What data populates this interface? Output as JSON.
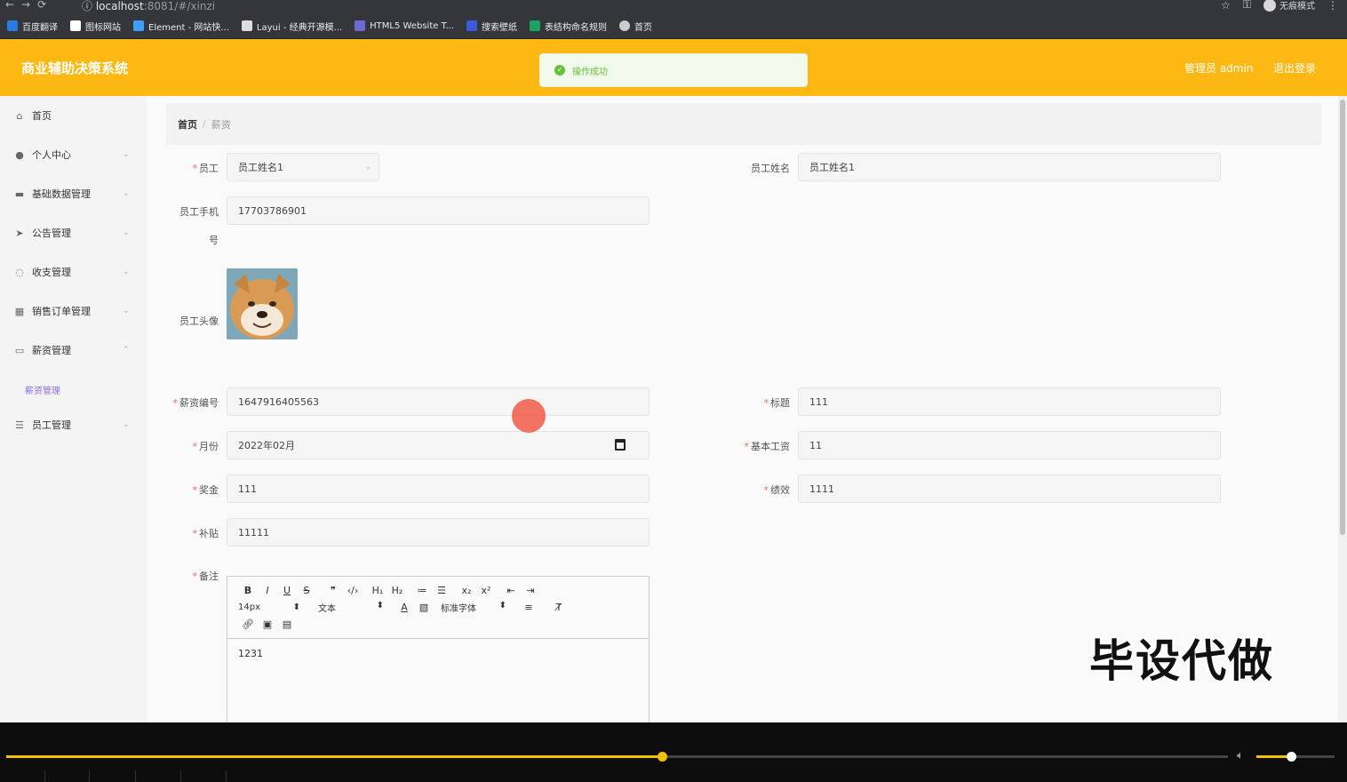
{
  "browser": {
    "url_host": "localhost",
    "url_path": ":8081/#/xinzi",
    "incognito_label": "无痕模式",
    "bookmarks": [
      "百度翻译",
      "图标网站",
      "Element - 网站快...",
      "Layui - 经典开源模...",
      "HTML5 Website T...",
      "搜索壁纸",
      "表结构命名规则",
      "首页"
    ]
  },
  "app": {
    "title": "商业辅助决策系统",
    "user_label": "管理员 admin",
    "logout_label": "退出登录",
    "toast": "操作成功"
  },
  "sidebar": {
    "items": [
      "首页",
      "个人中心",
      "基础数据管理",
      "公告管理",
      "收支管理",
      "销售订单管理",
      "薪资管理",
      "员工管理"
    ],
    "sub_active": "薪资管理"
  },
  "breadcrumb": {
    "home": "首页",
    "current": "薪资"
  },
  "form": {
    "employee_label": "员工",
    "employee_value": "员工姓名1",
    "employee_name_label": "员工姓名",
    "employee_name_value": "员工姓名1",
    "phone_label_1": "员工手机",
    "phone_label_2": "号",
    "phone_value": "17703786901",
    "avatar_label": "员工头像",
    "salary_no_label": "薪资编号",
    "salary_no_value": "1647916405563",
    "title_label": "标题",
    "title_value": "111",
    "month_label": "月份",
    "month_value": "2022年02月",
    "base_salary_label": "基本工资",
    "base_salary_value": "11",
    "bonus_label": "奖金",
    "bonus_value": "111",
    "performance_label": "绩效",
    "performance_value": "1111",
    "allowance_label": "补贴",
    "allowance_value": "11111",
    "remark_label": "备注",
    "remark_value": "1231",
    "editor_font_size": "14px",
    "editor_text_type": "文本",
    "editor_font_family": "标准字体"
  },
  "watermark": "毕设代做",
  "player": {
    "progress": 0.537,
    "volume": 0.44
  }
}
